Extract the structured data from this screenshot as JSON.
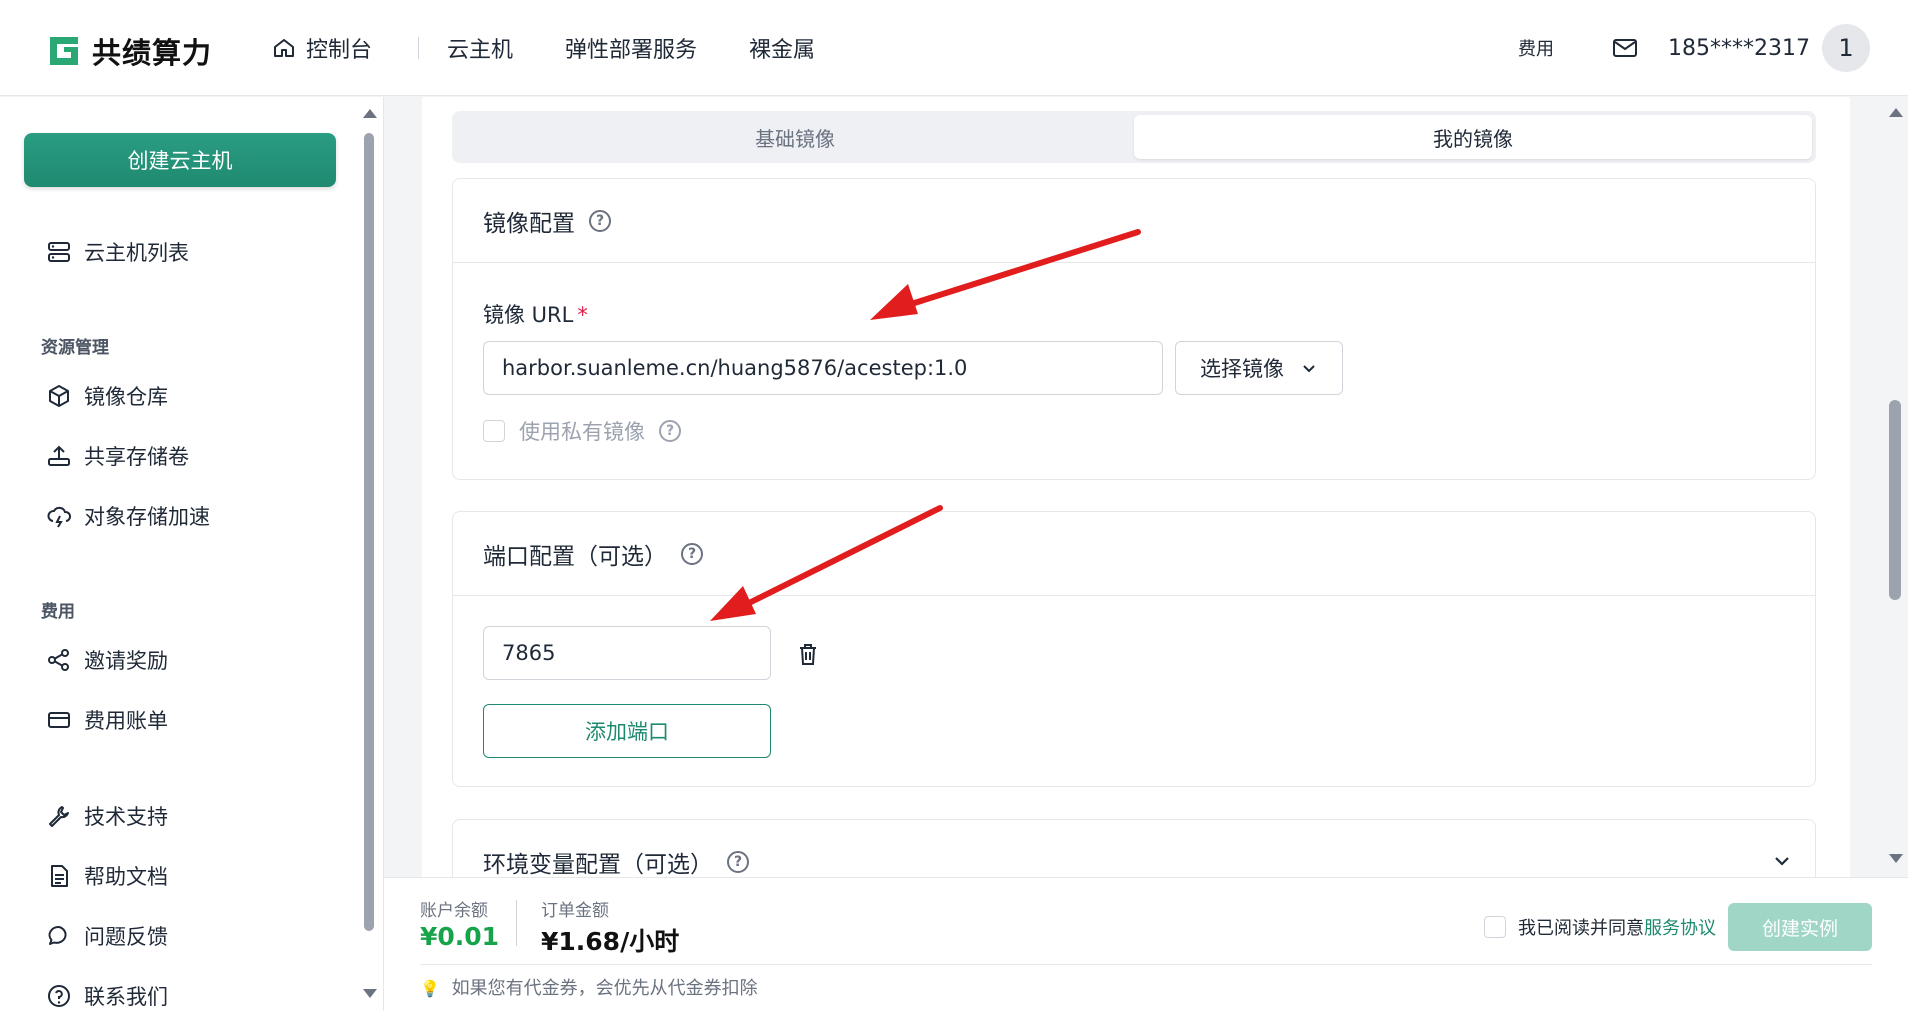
{
  "header": {
    "brand": "共绩算力",
    "nav": [
      {
        "label": "控制台"
      },
      {
        "label": "云主机"
      },
      {
        "label": "弹性部署服务"
      },
      {
        "label": "裸金属"
      }
    ],
    "fee_label": "费用",
    "phone": "185****2317",
    "avatar_text": "1"
  },
  "sidebar": {
    "create_label": "创建云主机",
    "items": [
      {
        "label": "云主机列表"
      },
      {
        "label": "镜像仓库"
      },
      {
        "label": "共享存储卷"
      },
      {
        "label": "对象存储加速"
      },
      {
        "label": "邀请奖励"
      },
      {
        "label": "费用账单"
      },
      {
        "label": "技术支持"
      },
      {
        "label": "帮助文档"
      },
      {
        "label": "问题反馈"
      },
      {
        "label": "联系我们"
      }
    ],
    "groups": [
      "资源管理",
      "费用"
    ]
  },
  "tabs": [
    {
      "label": "基础镜像",
      "active": false
    },
    {
      "label": "我的镜像",
      "active": true
    }
  ],
  "image_config": {
    "title": "镜像配置",
    "url_label": "镜像 URL",
    "required_mark": "*",
    "url_value": "harbor.suanleme.cn/huang5876/acestep:1.0",
    "select_label": "选择镜像",
    "private_label": "使用私有镜像"
  },
  "port_config": {
    "title": "端口配置（可选）",
    "port_value": "7865",
    "add_label": "添加端口"
  },
  "env_config": {
    "title": "环境变量配置（可选）"
  },
  "footer": {
    "balance_label": "账户余额",
    "balance_value": "¥0.01",
    "order_label": "订单金额",
    "order_value": "¥1.68/小时",
    "agree_text": "我已阅读并同意",
    "agree_link": "服务协议",
    "create_label": "创建实例",
    "tip": "如果您有代金券，会优先从代金券扣除"
  },
  "colors": {
    "accent": "#1f8a70",
    "balance": "#16a34a",
    "annotation_arrow": "#e11d1d"
  }
}
